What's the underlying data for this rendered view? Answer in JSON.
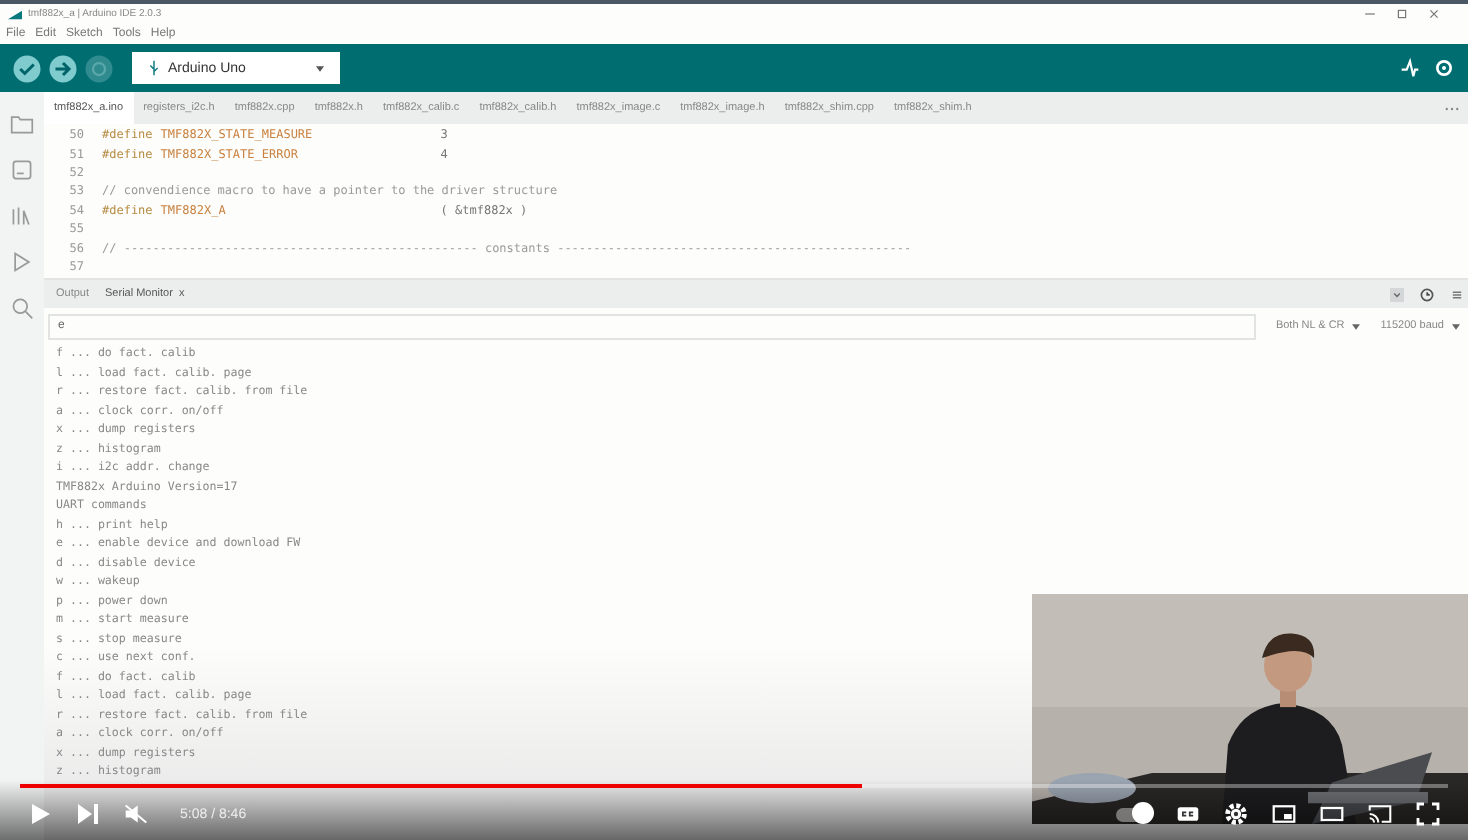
{
  "window": {
    "title": "tmf882x_a | Arduino IDE 2.0.3"
  },
  "menu": [
    "File",
    "Edit",
    "Sketch",
    "Tools",
    "Help"
  ],
  "board": {
    "name": "Arduino Uno"
  },
  "file_tabs": [
    {
      "label": "tmf882x_a.ino",
      "selected": true
    },
    {
      "label": "registers_i2c.h",
      "selected": false
    },
    {
      "label": "tmf882x.cpp",
      "selected": false
    },
    {
      "label": "tmf882x.h",
      "selected": false
    },
    {
      "label": "tmf882x_calib.c",
      "selected": false
    },
    {
      "label": "tmf882x_calib.h",
      "selected": false
    },
    {
      "label": "tmf882x_image.c",
      "selected": false
    },
    {
      "label": "tmf882x_image.h",
      "selected": false
    },
    {
      "label": "tmf882x_shim.cpp",
      "selected": false
    },
    {
      "label": "tmf882x_shim.h",
      "selected": false
    }
  ],
  "code": [
    {
      "number": "50",
      "kind": "define",
      "keyword": "#define",
      "name": "TMF882X_STATE_MEASURE",
      "value": "3"
    },
    {
      "number": "51",
      "kind": "define",
      "keyword": "#define",
      "name": "TMF882X_STATE_ERROR",
      "value": "4"
    },
    {
      "number": "52",
      "kind": "blank"
    },
    {
      "number": "53",
      "kind": "comment",
      "text": "// convendience macro to have a pointer to the driver structure"
    },
    {
      "number": "54",
      "kind": "define",
      "keyword": "#define",
      "name": "TMF882X_A",
      "value": "( &tmf882x )"
    },
    {
      "number": "55",
      "kind": "blank"
    },
    {
      "number": "56",
      "kind": "comment",
      "text": "// ------------------------------------------------- constants -------------------------------------------------"
    },
    {
      "number": "57",
      "kind": "blank"
    }
  ],
  "panel": {
    "tabs": [
      {
        "label": "Output",
        "selected": false
      },
      {
        "label": "Serial Monitor",
        "selected": true,
        "close": "x"
      }
    ]
  },
  "serial": {
    "input": "e",
    "line_ending": "Both NL & CR",
    "baud": "115200 baud",
    "lines": [
      "f ... do fact. calib",
      "l ... load fact. calib. page",
      "r ... restore fact. calib. from file",
      "a ... clock corr. on/off",
      "x ... dump registers",
      "z ... histogram",
      "i ... i2c addr. change",
      "TMF882x Arduino Version=17",
      "UART commands",
      "h ... print help",
      "e ... enable device and download FW",
      "d ... disable device",
      "w ... wakeup",
      "p ... power down",
      "m ... start measure",
      "s ... stop measure",
      "c ... use next conf.",
      "f ... do fact. calib",
      "l ... load fact. calib. page",
      "r ... restore fact. calib. from file",
      "a ... clock corr. on/off",
      "x ... dump registers",
      "z ... histogram"
    ]
  },
  "player": {
    "level": 0.59,
    "time": "5:08 / 8:46",
    "autoplay": true
  }
}
